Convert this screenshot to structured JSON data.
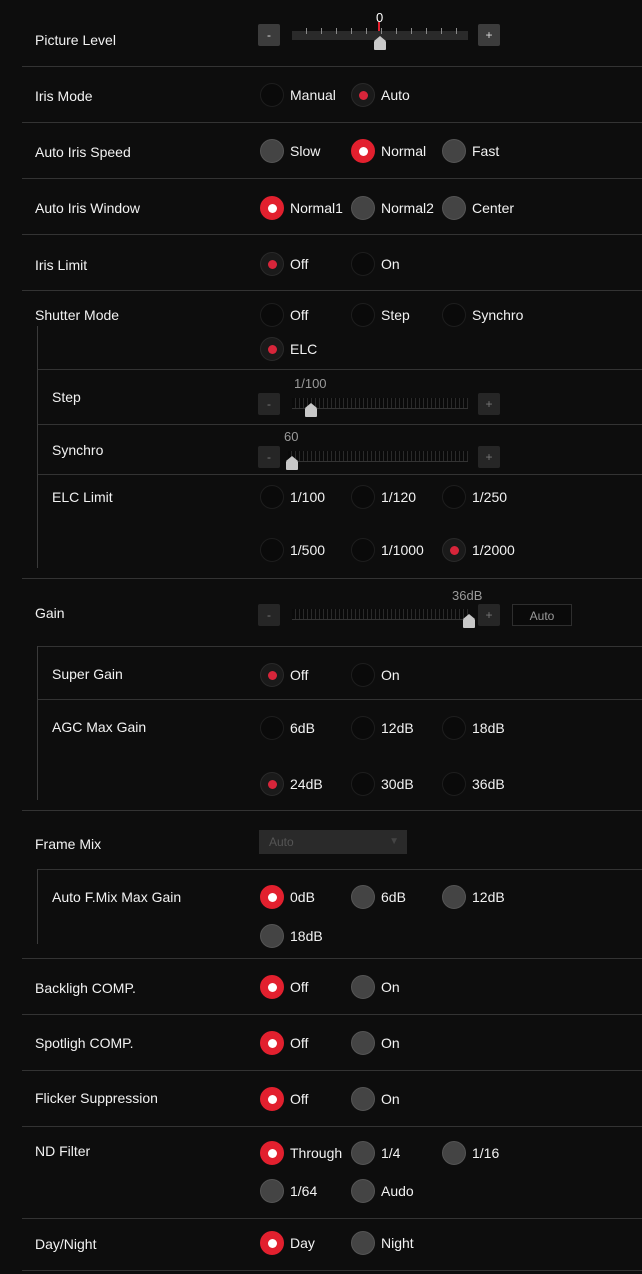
{
  "picture_level": {
    "label": "Picture Level",
    "value": "0",
    "minus": "-",
    "plus": "+"
  },
  "iris_mode": {
    "label": "Iris Mode",
    "options": [
      "Manual",
      "Auto"
    ],
    "selected": "Auto"
  },
  "auto_iris_speed": {
    "label": "Auto Iris Speed",
    "options": [
      "Slow",
      "Normal",
      "Fast"
    ],
    "selected": "Normal"
  },
  "auto_iris_window": {
    "label": "Auto Iris Window",
    "options": [
      "Normal1",
      "Normal2",
      "Center"
    ],
    "selected": "Normal1"
  },
  "iris_limit": {
    "label": "Iris Limit",
    "options": [
      "Off",
      "On"
    ],
    "selected": "Off"
  },
  "shutter_mode": {
    "label": "Shutter Mode",
    "options": [
      "Off",
      "Step",
      "Synchro",
      "ELC"
    ],
    "selected": "ELC",
    "step": {
      "label": "Step",
      "value": "1/100",
      "minus": "-",
      "plus": "+"
    },
    "synchro": {
      "label": "Synchro",
      "value": "60",
      "minus": "-",
      "plus": "+"
    },
    "elc_limit": {
      "label": "ELC Limit",
      "options": [
        "1/100",
        "1/120",
        "1/250",
        "1/500",
        "1/1000",
        "1/2000"
      ],
      "selected": "1/2000"
    }
  },
  "gain": {
    "label": "Gain",
    "value": "36dB",
    "minus": "-",
    "plus": "+",
    "auto_button": "Auto",
    "super_gain": {
      "label": "Super Gain",
      "options": [
        "Off",
        "On"
      ],
      "selected": "Off"
    },
    "agc_max_gain": {
      "label": "AGC Max Gain",
      "options": [
        "6dB",
        "12dB",
        "18dB",
        "24dB",
        "30dB",
        "36dB"
      ],
      "selected": "24dB"
    }
  },
  "frame_mix": {
    "label": "Frame Mix",
    "select_value": "Auto",
    "auto_fmix_max_gain": {
      "label": "Auto F.Mix Max Gain",
      "options": [
        "0dB",
        "6dB",
        "12dB",
        "18dB"
      ],
      "selected": "0dB"
    }
  },
  "backlight_comp": {
    "label": "Backligh COMP.",
    "options": [
      "Off",
      "On"
    ],
    "selected": "Off"
  },
  "spotlight_comp": {
    "label": "Spotligh COMP.",
    "options": [
      "Off",
      "On"
    ],
    "selected": "Off"
  },
  "flicker_suppression": {
    "label": "Flicker Suppression",
    "options": [
      "Off",
      "On"
    ],
    "selected": "Off"
  },
  "nd_filter": {
    "label": "ND Filter",
    "options": [
      "Through",
      "1/4",
      "1/16",
      "1/64",
      "Audo"
    ],
    "selected": "Through"
  },
  "day_night": {
    "label": "Day/Night",
    "options": [
      "Day",
      "Night"
    ],
    "selected": "Day"
  },
  "colors": {
    "accent": "#e2202e",
    "background": "#0d0d0d",
    "separator": "#333333"
  }
}
